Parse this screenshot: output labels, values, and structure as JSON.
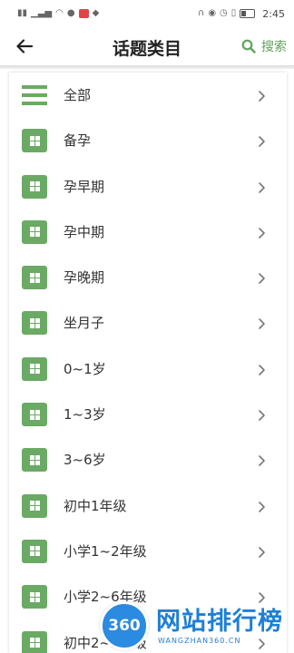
{
  "status_bar": {
    "time": "2:45",
    "left_icons": [
      "signal-icon",
      "signal-icon",
      "wifi-icon",
      "notification-icon",
      "app-icon",
      "qq-icon"
    ],
    "right_icons": [
      "headset-icon",
      "eye-icon",
      "alarm-icon",
      "vibrate-icon",
      "battery-icon"
    ]
  },
  "header": {
    "title": "话题类目",
    "search_label": "搜索"
  },
  "categories": [
    {
      "label": "全部",
      "icon": "list-icon"
    },
    {
      "label": "备孕",
      "icon": "grid-icon"
    },
    {
      "label": "孕早期",
      "icon": "grid-icon"
    },
    {
      "label": "孕中期",
      "icon": "grid-icon"
    },
    {
      "label": "孕晚期",
      "icon": "grid-icon"
    },
    {
      "label": "坐月子",
      "icon": "grid-icon"
    },
    {
      "label": "0~1岁",
      "icon": "grid-icon"
    },
    {
      "label": "1~3岁",
      "icon": "grid-icon"
    },
    {
      "label": "3~6岁",
      "icon": "grid-icon"
    },
    {
      "label": "初中1年级",
      "icon": "grid-icon"
    },
    {
      "label": "小学1~2年级",
      "icon": "grid-icon"
    },
    {
      "label": "小学2~6年级",
      "icon": "grid-icon"
    },
    {
      "label": "初中2~3年级",
      "icon": "grid-icon"
    }
  ],
  "watermark": {
    "badge": "360",
    "title": "网站排行榜",
    "subtitle": "WANGZHAN360.CN"
  },
  "colors": {
    "accent_green": "#6aaa64",
    "search_green": "#5fa35a",
    "watermark_blue": "#1e7fd6"
  }
}
